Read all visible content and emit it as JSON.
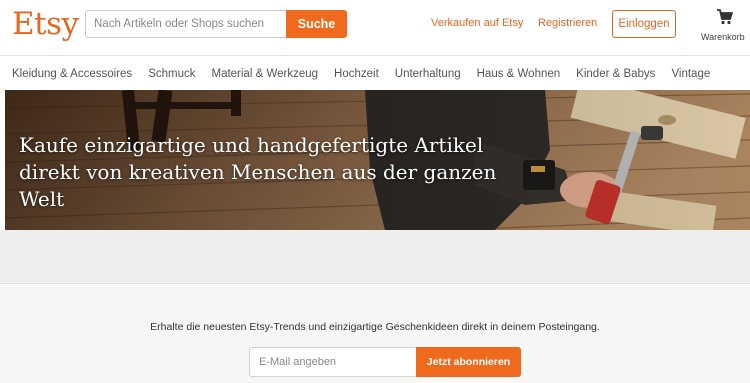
{
  "header": {
    "logo": "Etsy",
    "search": {
      "placeholder": "Nach Artikeln oder Shops suchen",
      "button_label": "Suche"
    },
    "links": {
      "sell": "Verkaufen auf Etsy",
      "register": "Registrieren"
    },
    "login_label": "Einloggen",
    "cart_label": "Warenkorb",
    "cart_icon": "shopping-cart-icon"
  },
  "categories": [
    "Kleidung & Accessoires",
    "Schmuck",
    "Material & Werkzeug",
    "Hochzeit",
    "Unterhaltung",
    "Haus & Wohnen",
    "Kinder & Babys",
    "Vintage"
  ],
  "hero": {
    "title": "Kaufe einzigartige und handgefertigte Artikel direkt von kreativen Menschen aus der ganzen Welt"
  },
  "newsletter": {
    "text": "Erhalte die neuesten Etsy-Trends und einzigartige Geschenkideen direkt in deinem Posteingang.",
    "placeholder": "E-Mail angeben",
    "button_label": "Jetzt abonnieren"
  },
  "colors": {
    "brand": "#f06a1e",
    "link": "#e8661f"
  }
}
